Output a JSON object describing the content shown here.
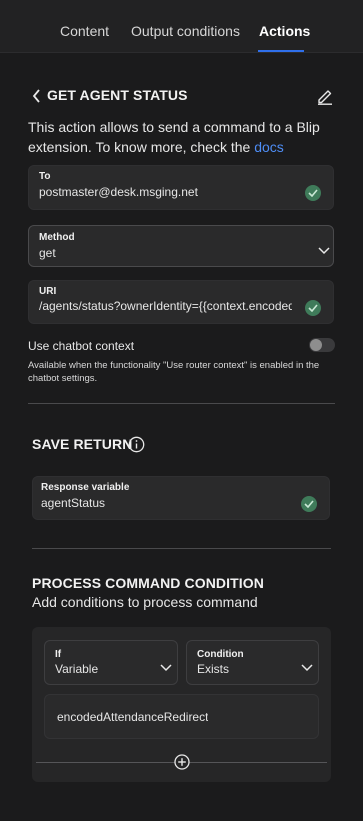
{
  "tabs": [
    {
      "label": "Content"
    },
    {
      "label": "Output conditions"
    },
    {
      "label": "Actions",
      "active": true
    }
  ],
  "action": {
    "title": "GET AGENT STATUS",
    "description": "This action allows to send a command to a Blip extension. To know more, check the",
    "link_text": "docs"
  },
  "fields": {
    "to": {
      "label": "To",
      "value": "postmaster@desk.msging.net"
    },
    "method": {
      "label": "Method",
      "value": "get"
    },
    "uri": {
      "label": "URI",
      "value": "/agents/status?ownerIdentity={{context.encodedAttendanceRedirect}}"
    }
  },
  "chatbot_context": {
    "label": "Use chatbot context",
    "help": "Available when the functionality \"Use router context\" is enabled in the chatbot settings.",
    "enabled": false
  },
  "save_return": {
    "title": "SAVE RETURN",
    "response_label": "Response variable",
    "response_value": "agentStatus"
  },
  "process_condition": {
    "title": "PROCESS COMMAND CONDITION",
    "subtitle": "Add conditions to process command",
    "if_label": "If",
    "if_value": "Variable",
    "condition_label": "Condition",
    "condition_value": "Exists",
    "variable_value": "encodedAttendanceRedirect"
  },
  "colors": {
    "accent": "#2f6fea",
    "link": "#4e8df5",
    "success": "#3f7b5a",
    "background": "#1b1b1c"
  }
}
